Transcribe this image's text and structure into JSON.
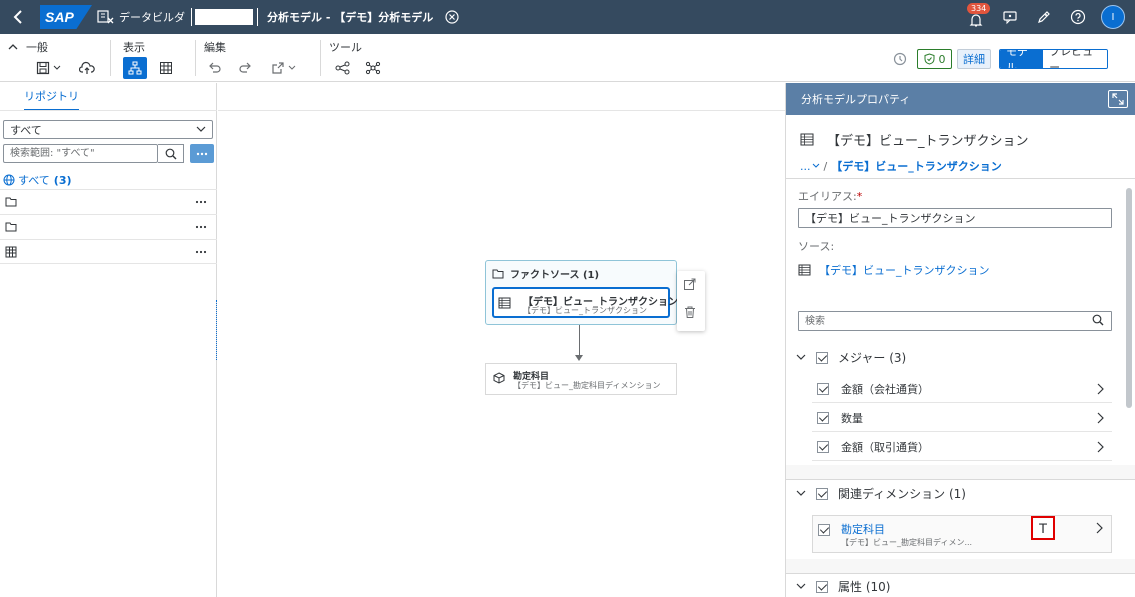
{
  "shell": {
    "logo": "SAP",
    "app_name": "データビルダ",
    "title": "分析モデル - 【デモ】分析モデル",
    "notification_count": "334",
    "avatar_initial": "I"
  },
  "toolbar": {
    "groups": {
      "general": "一般",
      "view": "表示",
      "edit": "編集",
      "tools": "ツール"
    },
    "validation_count": "0",
    "details_label": "詳細",
    "mode_model": "モデル",
    "mode_preview": "プレビュー"
  },
  "left": {
    "tab": "リポジトリ",
    "filter_value": "すべて",
    "search_placeholder": "検索範囲: \"すべて\"",
    "all_label": "すべて",
    "all_count": "(3)"
  },
  "canvas": {
    "fact_header": "ファクトソース (1)",
    "fact_name": "【デモ】ビュー_トランザクション",
    "fact_sub": "【デモ】ビュー_トランザクション",
    "dim_name": "勘定科目",
    "dim_sub": "【デモ】ビュー_勘定科目ディメンション"
  },
  "right": {
    "header": "分析モデルプロパティ",
    "subtitle": "【デモ】ビュー_トランザクション",
    "breadcrumb_prefix": "...",
    "breadcrumb_current": "【デモ】ビュー_トランザクション",
    "alias_label": "エイリアス:",
    "alias_required": "*",
    "alias_value": "【デモ】ビュー_トランザクション",
    "source_label": "ソース:",
    "source_value": "【デモ】ビュー_トランザクション",
    "search_placeholder": "検索",
    "measures_label": "メジャー (3)",
    "measures": [
      {
        "label": "金額（会社通貨）"
      },
      {
        "label": "数量"
      },
      {
        "label": "金額（取引通貨）"
      }
    ],
    "dimensions_label": "関連ディメンション (1)",
    "dimension_item": {
      "name": "勘定科目",
      "sub": "【デモ】ビュー_勘定科目ディメン..."
    },
    "dimension_button": "T",
    "attributes_label": "属性 (10)"
  }
}
